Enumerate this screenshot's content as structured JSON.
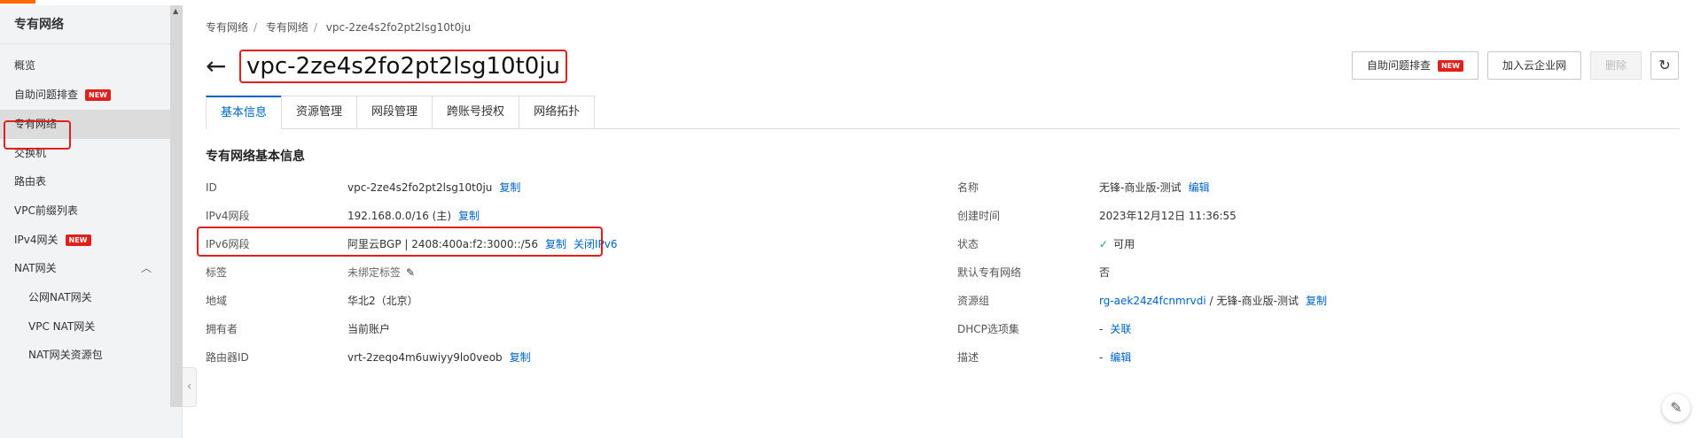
{
  "sidebar": {
    "title": "专有网络",
    "items": [
      {
        "label": "概览"
      },
      {
        "label": "自助问题排查",
        "badge": "NEW"
      },
      {
        "label": "专有网络",
        "active": true
      },
      {
        "label": "交换机"
      },
      {
        "label": "路由表"
      },
      {
        "label": "VPC前缀列表"
      },
      {
        "label": "IPv4网关",
        "badge": "NEW"
      },
      {
        "label": "NAT网关"
      },
      {
        "label": "公网NAT网关"
      },
      {
        "label": "VPC NAT网关"
      },
      {
        "label": "NAT网关资源包"
      }
    ]
  },
  "breadcrumb": [
    "专有网络",
    "专有网络",
    "vpc-2ze4s2fo2pt2lsg10t0ju"
  ],
  "header": {
    "title": "vpc-2ze4s2fo2pt2lsg10t0ju",
    "back_glyph": "←",
    "actions": {
      "troubleshoot": "自助问题排查",
      "troubleshoot_badge": "NEW",
      "join_cen": "加入云企业网",
      "delete": "删除",
      "refresh_glyph": "↻"
    }
  },
  "tabs": [
    "基本信息",
    "资源管理",
    "网段管理",
    "跨账号授权",
    "网络拓扑"
  ],
  "section_title": "专有网络基本信息",
  "left_info": [
    {
      "key": "ID",
      "value": "vpc-2ze4s2fo2pt2lsg10t0ju",
      "link": "复制"
    },
    {
      "key": "IPv4网段",
      "value": "192.168.0.0/16 (主)",
      "link": "复制"
    },
    {
      "key": "IPv6网段",
      "value": "阿里云BGP | 2408:400a:f2:3000::/56",
      "link": "复制",
      "link2": "关闭IPv6"
    },
    {
      "key": "标签",
      "value": "未绑定标签",
      "pencil": "✎"
    },
    {
      "key": "地域",
      "value": "华北2（北京）"
    },
    {
      "key": "拥有者",
      "value": "当前账户"
    },
    {
      "key": "路由器ID",
      "value": "vrt-2zeqo4m6uwiyy9lo0veob",
      "link": "复制"
    }
  ],
  "right_info": [
    {
      "key": "名称",
      "value": "无锋-商业版-测试",
      "link": "编辑"
    },
    {
      "key": "创建时间",
      "value": "2023年12月12日 11:36:55"
    },
    {
      "key": "状态",
      "value": "可用",
      "check": "✓"
    },
    {
      "key": "默认专有网络",
      "value": "否"
    },
    {
      "key": "资源组",
      "value_link": "rg-aek24z4fcnmrvdi",
      "value": " / 无锋-商业版-测试",
      "link": "复制"
    },
    {
      "key": "DHCP选项集",
      "value": "-",
      "link": "关联"
    },
    {
      "key": "描述",
      "value": "-",
      "link": "编辑"
    }
  ],
  "colors": {
    "accent": "#0064c8",
    "highlight": "#e0201a",
    "brand": "#ff6a00",
    "ok": "#26a15c"
  }
}
